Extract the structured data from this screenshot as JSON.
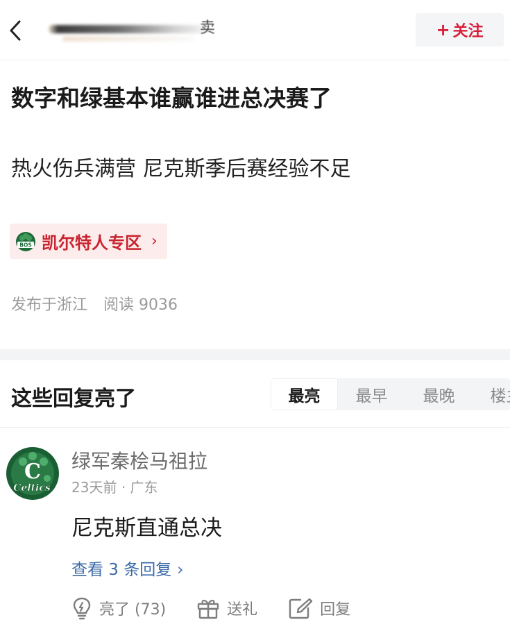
{
  "header": {
    "back_icon": "chevron-left-icon",
    "author_name_obscured_char": "卖",
    "follow_label": "关注",
    "follow_plus": "+"
  },
  "post": {
    "title": "数字和绿基本谁赢谁进总决赛了",
    "body": "热火伤兵满营 尼克斯季后赛经验不足",
    "zone_tag": {
      "label": "凯尔特人专区",
      "icon": "celtics-bos-logo-icon",
      "icon_text": "BOS"
    },
    "published_location": "发布于浙江",
    "reads": "阅读 9036"
  },
  "replies": {
    "section_title": "这些回复亮了",
    "sort_tabs": [
      {
        "label": "最亮",
        "active": true
      },
      {
        "label": "最早",
        "active": false
      },
      {
        "label": "最晚",
        "active": false
      },
      {
        "label": "楼主",
        "active": false
      }
    ],
    "comments": [
      {
        "username": "绿军秦桧马祖拉",
        "time_ago": "23天前",
        "location": "广东",
        "text": "尼克斯直通总决",
        "view_replies": "查看 3 条回复",
        "avatar_icon": "celtics-avatar-icon",
        "avatar_text": "Celtics",
        "actions": {
          "like_label": "亮了 (73)",
          "gift_label": "送礼",
          "reply_label": "回复"
        }
      }
    ]
  },
  "colors": {
    "accent_red": "#d81e3b",
    "link_blue": "#3b6aa8",
    "tag_bg": "#fdecec",
    "celtics_green": "#1f6b3a"
  }
}
